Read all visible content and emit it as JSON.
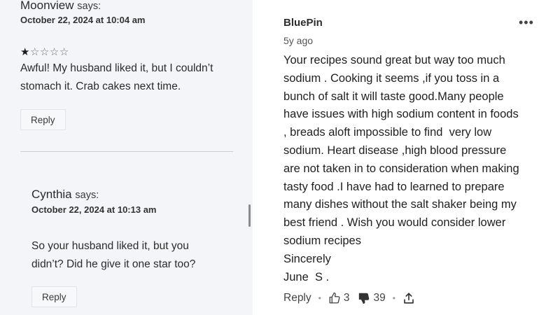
{
  "left_panel": {
    "comment1": {
      "author": "Moonview",
      "says": "says:",
      "date": "October 22, 2024 at 10:04 am",
      "rating": {
        "filled": 1,
        "total": 5
      },
      "lines": [
        "Awful! My husband liked it, but I couldn’t",
        "stomach it. Crab cakes next time."
      ],
      "reply_label": "Reply"
    },
    "comment2": {
      "author": "Cynthia",
      "says": "says:",
      "date": "October 22, 2024 at 10:13 am",
      "lines": [
        "So your husband liked it, but you",
        "didn’t? Did he give it one star too?"
      ],
      "reply_label": "Reply"
    }
  },
  "right_panel": {
    "username": "BluePin",
    "time_ago": "5y ago",
    "more_label": "•••",
    "lines": [
      "Your recipes sound great but way too much",
      "sodium . Cooking it seems ,if you toss in a",
      "bunch of salt it will taste good.Many people",
      "have issues with high sodium content in foods",
      ", breads aloft impossible to find  very low",
      "sodium. Heart disease ,high blood pressure",
      "are not taken in to consideration when making",
      "tasty food .I have had to learned to prepare",
      "many dishes without the salt shaker being my",
      "best friend . Wish you would consider lower",
      "sodium recipes",
      "Sincerely",
      "June  S ."
    ],
    "actions": {
      "reply_label": "Reply",
      "separator": "•",
      "likes": "3",
      "dislikes": "39"
    }
  }
}
